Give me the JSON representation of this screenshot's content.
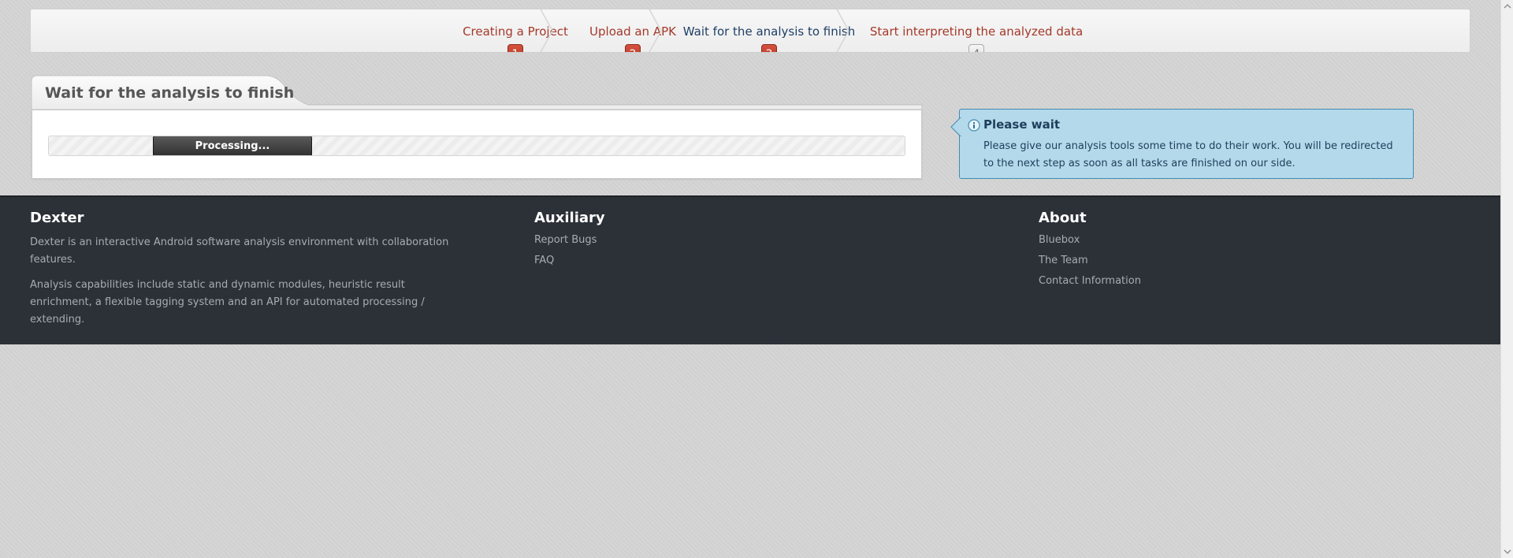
{
  "wizard": {
    "steps": [
      {
        "label": "Creating a Project",
        "number": "1",
        "state": "done"
      },
      {
        "label": "Upload an APK",
        "number": "2",
        "state": "done"
      },
      {
        "label": "Wait for the analysis to finish",
        "number": "3",
        "state": "active"
      },
      {
        "label": "Start interpreting the analyzed data",
        "number": "4",
        "state": "pending"
      }
    ]
  },
  "panel": {
    "title": "Wait for the analysis to finish",
    "progress_label": "Processing..."
  },
  "info": {
    "icon": "info-icon",
    "title": "Please wait",
    "text": "Please give our analysis tools some time to do their work. You will be redirected to the next step as soon as all tasks are finished on our side."
  },
  "footer": {
    "dexter": {
      "title": "Dexter",
      "line1": "Dexter is an interactive Android software analysis environment with collaboration features.",
      "line2": "Analysis capabilities include static and dynamic modules, heuristic result enrichment, a flexible tagging system and an API for automated processing / extending."
    },
    "auxiliary": {
      "title": "Auxiliary",
      "links": [
        "Report Bugs",
        "FAQ"
      ]
    },
    "about": {
      "title": "About",
      "links": [
        "Bluebox",
        "The Team",
        "Contact Information"
      ]
    }
  },
  "colors": {
    "step_link": "#a5382a",
    "step_active": "#1f3f66",
    "badge": "#c4402e",
    "info_bg": "#b4d9ea",
    "footer_bg": "#2c3138"
  }
}
